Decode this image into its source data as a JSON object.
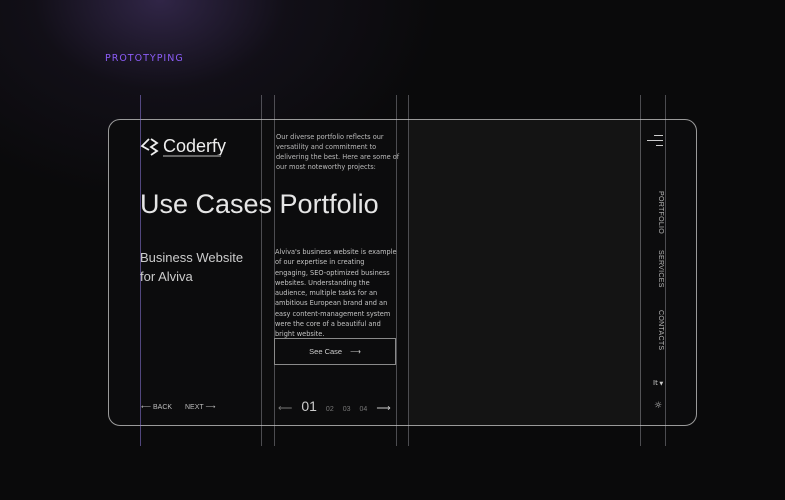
{
  "section_label": "PROTOTYPING",
  "brand": {
    "name": "Coderfy"
  },
  "intro": "Our diverse portfolio reflects our versatility and commitment to delivering the best. Here are some of our most noteworthy projects:",
  "title": "Use Cases Portfolio",
  "case": {
    "line1": "Business Website",
    "line2": "for Alviva",
    "description": "Alviva's business website is example of our expertise in creating engaging, SEO-optimized business websites. Understanding the audience, multiple tasks for an ambitious European brand and an easy content-management system were the core of a beautiful and bright website.",
    "button": "See Case"
  },
  "nav": {
    "back": "BACK",
    "next": "NEXT"
  },
  "pagination": {
    "current": "01",
    "pages": [
      "02",
      "03",
      "04"
    ]
  },
  "side_menu": [
    "PORTFOLIO",
    "SERVICES",
    "CONTACTS"
  ],
  "language": "It",
  "colors": {
    "accent": "#8b5cf6"
  }
}
